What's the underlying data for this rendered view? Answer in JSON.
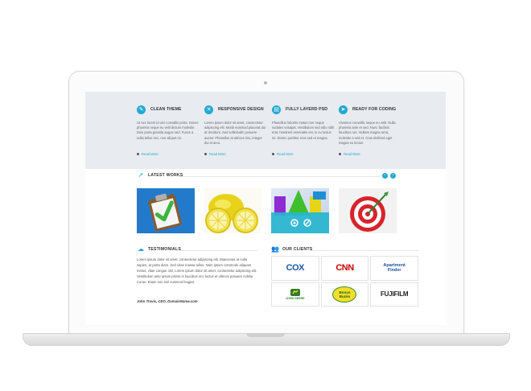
{
  "features": [
    {
      "icon": "pencil-icon",
      "glyph": "✎",
      "title": "CLEAN THEME",
      "text": "Ut nec lorem id orci convallis porta. Donec pharetra neque eu velit dictum molestie. Duis porta gravida augue sed. Fusce a nulla tellus nec, non aliquet mi.",
      "more": "Read More"
    },
    {
      "icon": "tools-icon",
      "glyph": "✕",
      "title": "RESPONSIVE DESIGN",
      "text": "Lorem ipsum dolor sit amet, consectetur adipiscing elit. Morbi euismod placerat dui at tincidunt. Sed sollicitudin posuere auctor. Phasellus at ultrices nisi, integer dui et arcu.",
      "more": "Read More"
    },
    {
      "icon": "document-icon",
      "glyph": "▤",
      "title": "FULLY LAYERD PSD",
      "text": "Phasellus lobortis metus non neque sodales volutpat. Vestibulum sed odio nibh erat, hendrerit venenatis est, in eu luctus mi. Donec porttitor eros sed et magna.",
      "more": "Read More"
    },
    {
      "icon": "cursor-icon",
      "glyph": "➤",
      "title": "READY FOR CODING",
      "text": "Vivamus convallis neque eu velit. Nulla pharetra ante et sed. Nunc facilisis faucibus nec. Nullam magna urna, molestie a sed et. Cras eleifend eget magna eu lectus.",
      "more": "Read More"
    }
  ],
  "latest_works": {
    "title": "LATEST WORKS",
    "icon": "cursor-icon"
  },
  "testimonials": {
    "title": "TESTIMONIALS",
    "icon": "speech-bubble-icon",
    "text": "Lorem ipsum dolor sit amet, consectetur adipiscing elit. Maecenas ut nulla sapien, at porta diam. Sed vitae massa tellus. Nam ipsum commodo aliquam metus, vitae congue nisl. Lorem ipsum dolor sit amet, consectetur adipiscing elit. Vestibulum ante ipsum primis in faucibus orci luctus et ultrices posuere cubilia Curae; Etiam non nisl euismod feugiat.",
    "author": "John Travis, CEO, DomainName.com"
  },
  "clients": {
    "title": "OUR CLIENTS",
    "icon": "users-icon",
    "logos": [
      "COX",
      "CNN",
      "Apartment Finder",
      "JOHN DEERE",
      "Bonus Bucks",
      "FUJIFILM"
    ]
  },
  "colors": {
    "accent": "#21a9d3",
    "feature_bg": "#e8ebf0"
  }
}
